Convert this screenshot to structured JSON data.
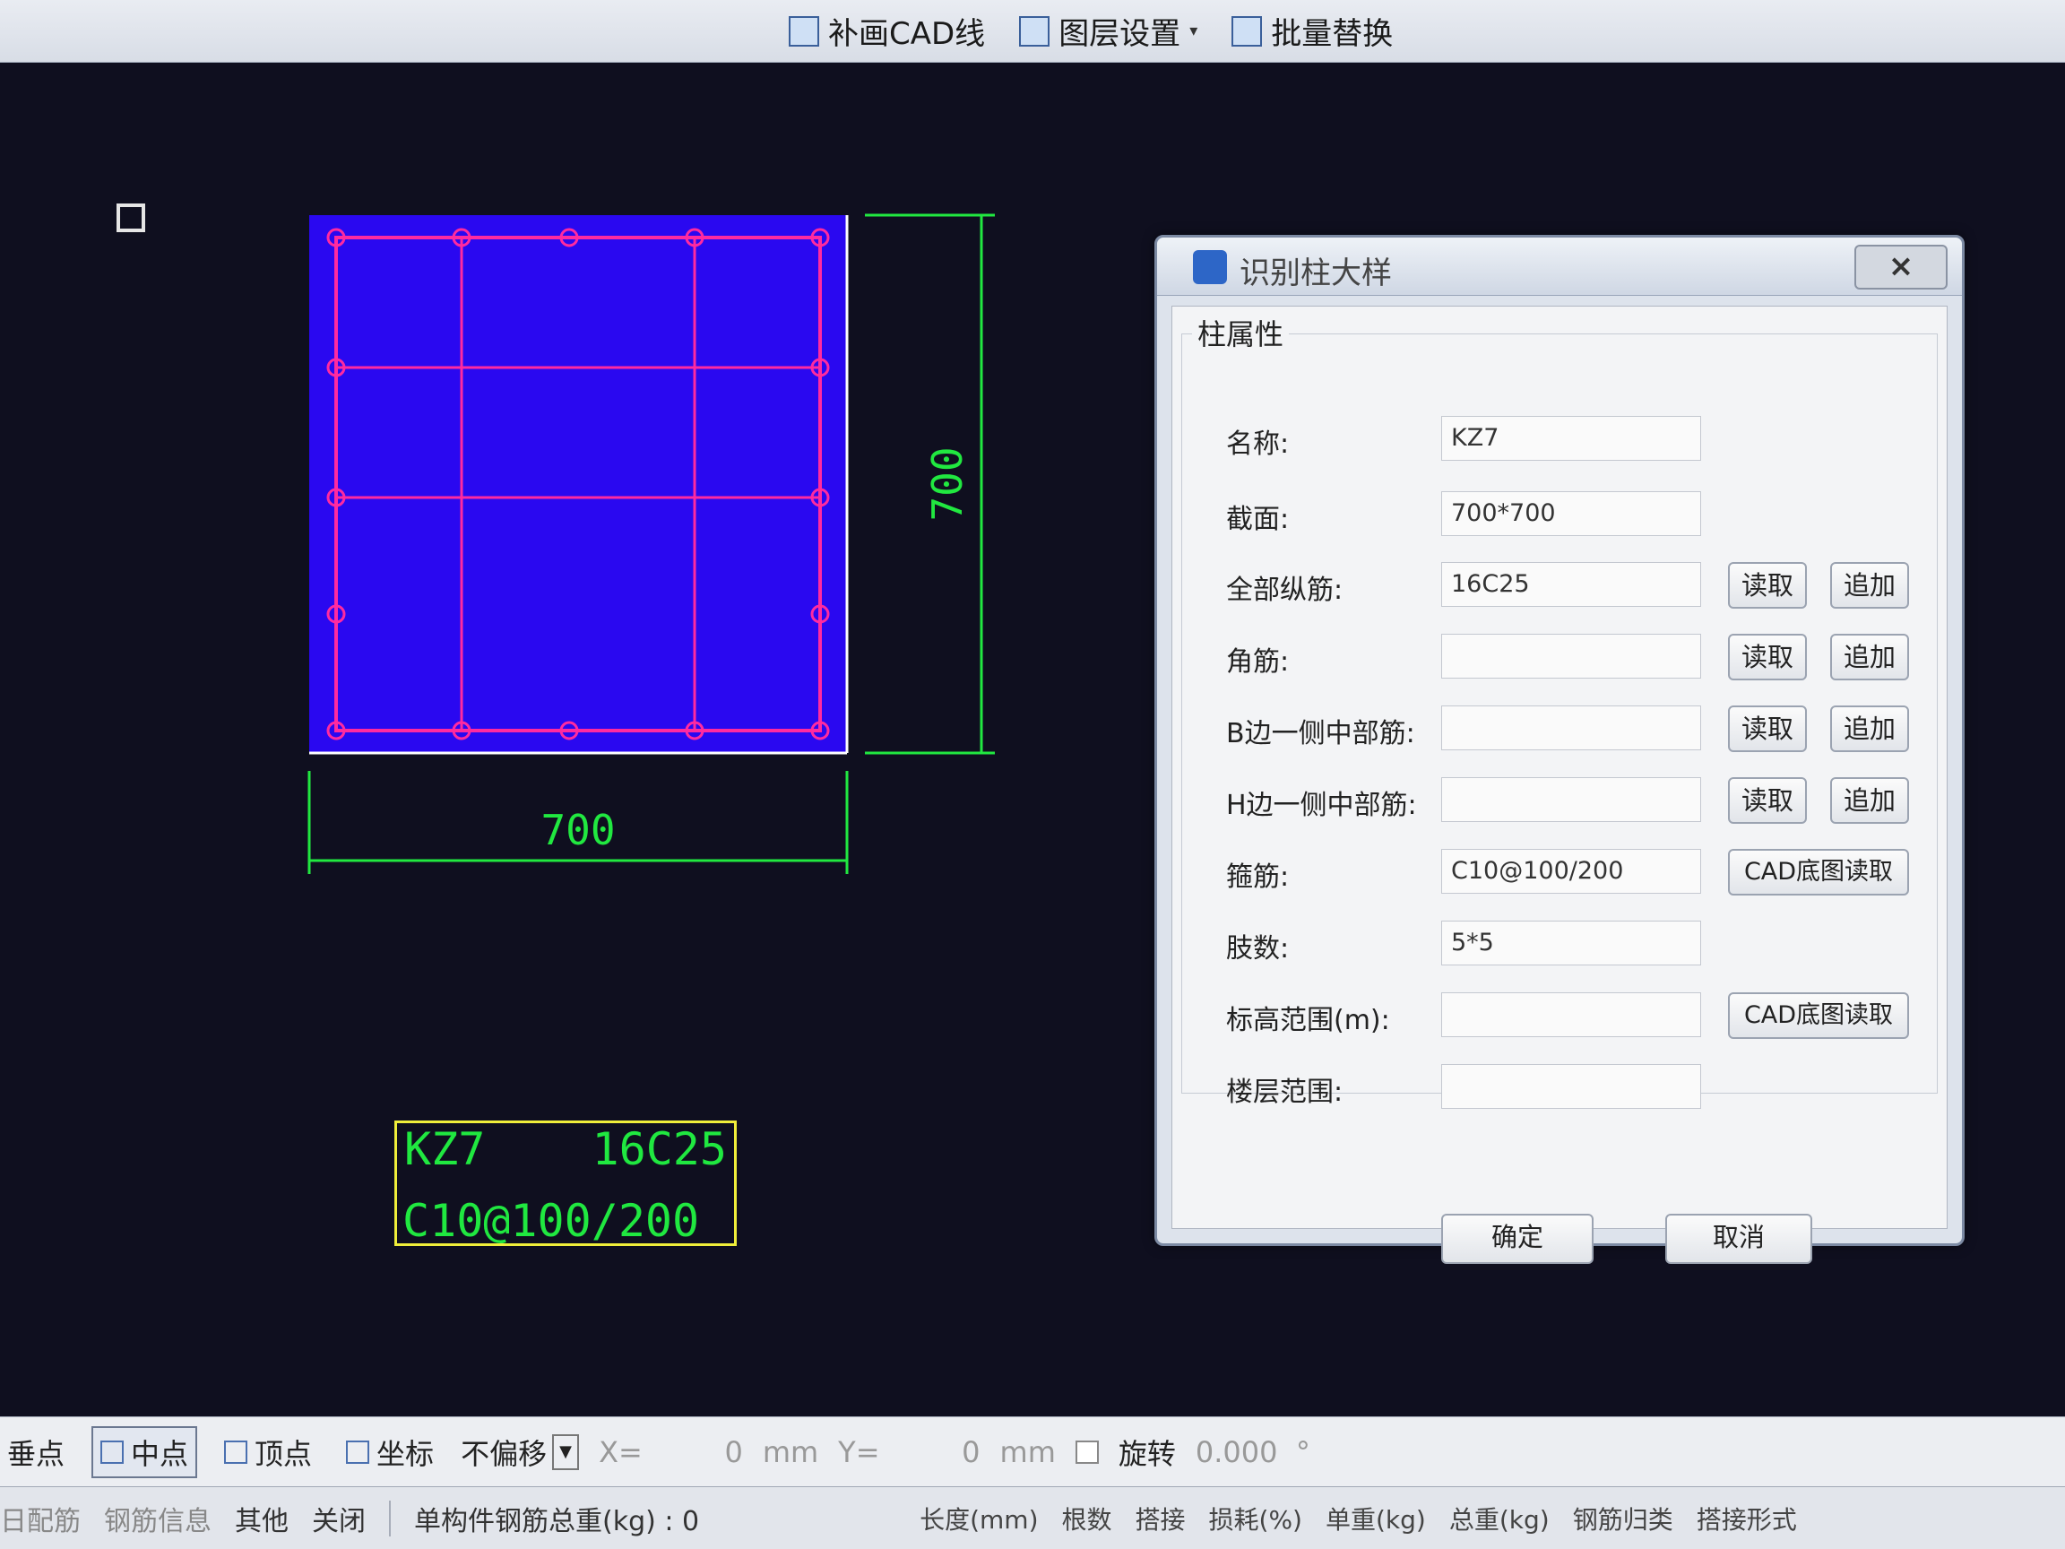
{
  "toolbar": {
    "items": [
      {
        "label": "补画CAD线",
        "icon": "pencil-line-icon"
      },
      {
        "label": "图层设置",
        "icon": "layers-icon",
        "dropdown": true
      },
      {
        "label": "批量替换",
        "icon": "batch-replace-icon"
      }
    ]
  },
  "drawing": {
    "width_dim": "700",
    "height_dim": "700",
    "section_color": "#2a08f0",
    "rebar_color": "#ff2aa0",
    "dim_color": "#21e840",
    "label_box": {
      "name": "KZ7",
      "bars": "16C25",
      "stirrup": "C10@100/200"
    }
  },
  "dialog": {
    "title": "识别柱大样",
    "close": "×",
    "group": "柱属性",
    "fields": [
      {
        "label": "名称:",
        "value": "KZ7",
        "buttons": []
      },
      {
        "label": "截面:",
        "value": "700*700",
        "buttons": []
      },
      {
        "label": "全部纵筋:",
        "value": "16C25",
        "buttons": [
          "读取",
          "追加"
        ]
      },
      {
        "label": "角筋:",
        "value": "",
        "buttons": [
          "读取",
          "追加"
        ]
      },
      {
        "label": "B边一侧中部筋:",
        "value": "",
        "buttons": [
          "读取",
          "追加"
        ]
      },
      {
        "label": "H边一侧中部筋:",
        "value": "",
        "buttons": [
          "读取",
          "追加"
        ]
      },
      {
        "label": "箍筋:",
        "value": "C10@100/200",
        "buttons": [
          "CAD底图读取"
        ]
      },
      {
        "label": "肢数:",
        "value": "5*5",
        "buttons": []
      },
      {
        "label": "标高范围(m):",
        "value": "",
        "buttons": [
          "CAD底图读取"
        ]
      },
      {
        "label": "楼层范围:",
        "value": "",
        "buttons": []
      }
    ],
    "ok": "确定",
    "cancel": "取消"
  },
  "snapbar": {
    "perpendicular": "垂点",
    "midpoint": "中点",
    "vertex": "顶点",
    "coordinate": "坐标",
    "offset_mode": "不偏移",
    "x_label": "X=",
    "x_value": "0",
    "x_unit": "mm",
    "y_label": "Y=",
    "y_value": "0",
    "y_unit": "mm",
    "rotate": "旋转",
    "angle": "0.000",
    "degree": "°"
  },
  "statusbar": {
    "rebar_config": "日配筋",
    "rebar_info": "钢筋信息",
    "other": "其他",
    "close": "关闭",
    "total_weight": "单构件钢筋总重(kg) : 0",
    "columns": [
      "长度(mm)",
      "根数",
      "搭接",
      "损耗(%)",
      "单重(kg)",
      "总重(kg)",
      "钢筋归类",
      "搭接形式"
    ]
  }
}
